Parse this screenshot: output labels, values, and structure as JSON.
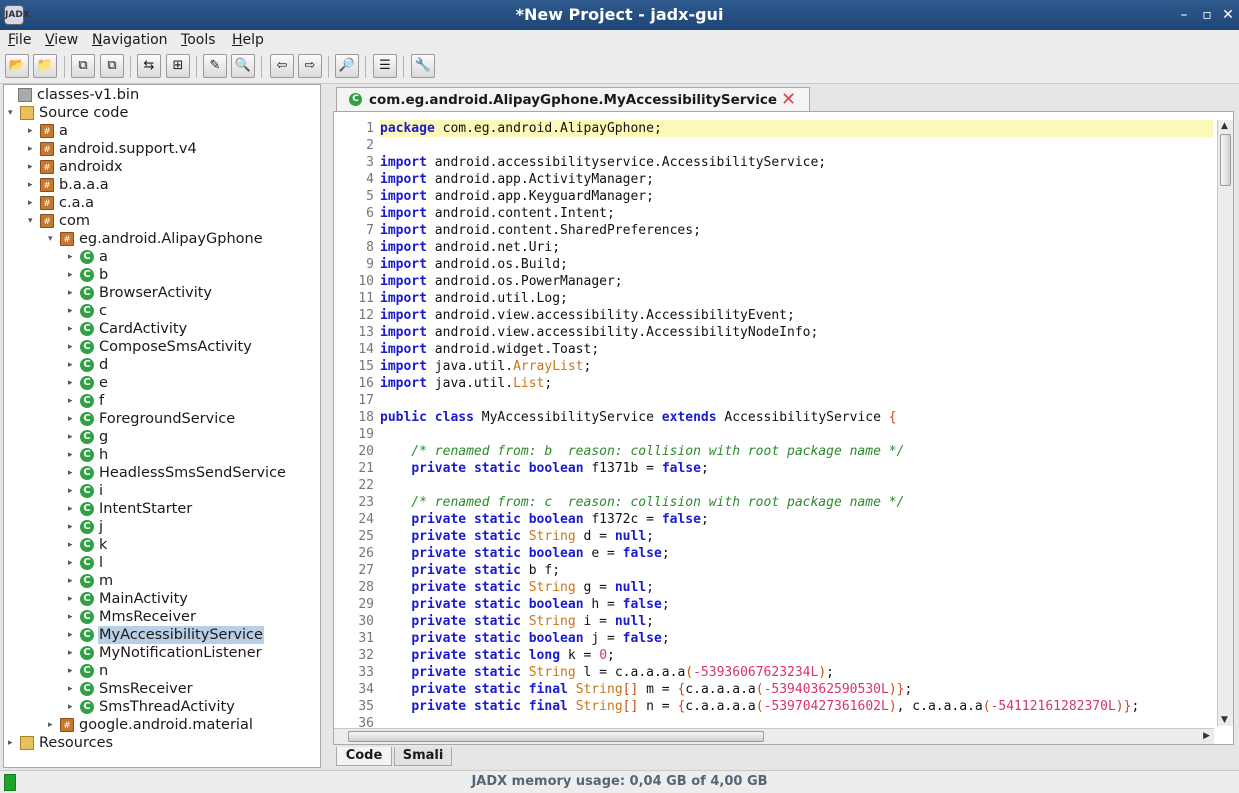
{
  "window": {
    "title": "*New Project - jadx-gui",
    "app_icon": "JADX"
  },
  "menus": [
    "File",
    "View",
    "Navigation",
    "Tools",
    "Help"
  ],
  "toolbar": {
    "buttons": [
      "open-file-icon",
      "add-files-icon",
      "copy-icon",
      "paste-icon",
      "sync-icon",
      "flatten-icon",
      "decompile-icon",
      "search-icon",
      "back-icon",
      "forward-icon",
      "search-package-icon",
      "log-viewer-icon",
      "preferences-icon"
    ]
  },
  "tree": {
    "root": "classes-v1.bin",
    "source_code": "Source code",
    "packages": [
      "a",
      "android.support.v4",
      "androidx",
      "b.a.a.a",
      "c.a.a",
      "com"
    ],
    "subpackage": "eg.android.AlipayGphone",
    "classes": [
      "a",
      "b",
      "BrowserActivity",
      "c",
      "CardActivity",
      "ComposeSmsActivity",
      "d",
      "e",
      "f",
      "ForegroundService",
      "g",
      "h",
      "HeadlessSmsSendService",
      "i",
      "IntentStarter",
      "j",
      "k",
      "l",
      "m",
      "MainActivity",
      "MmsReceiver",
      "MyAccessibilityService",
      "MyNotificationListener",
      "n",
      "SmsReceiver",
      "SmsThreadActivity"
    ],
    "selected": "MyAccessibilityService",
    "after_package": "google.android.material",
    "resources": "Resources"
  },
  "editor": {
    "tab_title": "com.eg.android.AlipayGphone.MyAccessibilityService",
    "bottom_tabs": [
      "Code",
      "Smali"
    ],
    "active_bottom_tab": "Code",
    "lines": [
      "package com.eg.android.AlipayGphone;",
      "",
      "import android.accessibilityservice.AccessibilityService;",
      "import android.app.ActivityManager;",
      "import android.app.KeyguardManager;",
      "import android.content.Intent;",
      "import android.content.SharedPreferences;",
      "import android.net.Uri;",
      "import android.os.Build;",
      "import android.os.PowerManager;",
      "import android.util.Log;",
      "import android.view.accessibility.AccessibilityEvent;",
      "import android.view.accessibility.AccessibilityNodeInfo;",
      "import android.widget.Toast;",
      "import java.util.ArrayList;",
      "import java.util.List;",
      "",
      "public class MyAccessibilityService extends AccessibilityService {",
      "",
      "    /* renamed from: b  reason: collision with root package name */",
      "    private static boolean f1371b = false;",
      "",
      "    /* renamed from: c  reason: collision with root package name */",
      "    private static boolean f1372c = false;",
      "    private static String d = null;",
      "    private static boolean e = false;",
      "    private static b f;",
      "    private static String g = null;",
      "    private static boolean h = false;",
      "    private static String i = null;",
      "    private static boolean j = false;",
      "    private static long k = 0;",
      "    private static String l = c.a.a.a.a(-53936067623234L);",
      "    private static final String[] m = {c.a.a.a.a(-53940362590530L)};",
      "    private static final String[] n = {c.a.a.a.a(-53970427361602L), c.a.a.a.a(-54112161282370L)};",
      ""
    ]
  },
  "status": {
    "memory_text": "JADX memory usage: 0,04 GB of 4,00 GB"
  }
}
